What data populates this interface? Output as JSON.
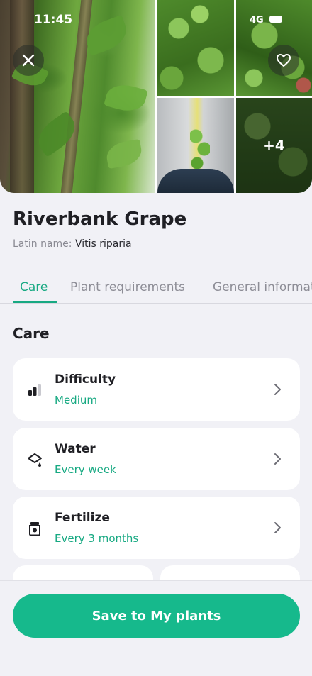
{
  "status_bar": {
    "time": "11:45",
    "network": "4G"
  },
  "gallery": {
    "more_count": "+4"
  },
  "plant": {
    "name": "Riverbank Grape",
    "latin_label": "Latin name:",
    "latin_value": "Vitis riparia"
  },
  "tabs": [
    {
      "label": "Care",
      "active": true
    },
    {
      "label": "Plant requirements",
      "active": false
    },
    {
      "label": "General information",
      "active": false
    }
  ],
  "care": {
    "title": "Care",
    "items": [
      {
        "title": "Difficulty",
        "value": "Medium",
        "icon": "signal-bars-icon"
      },
      {
        "title": "Water",
        "value": "Every week",
        "icon": "watering-can-icon"
      },
      {
        "title": "Fertilize",
        "value": "Every 3 months",
        "icon": "fertilizer-bag-icon"
      }
    ]
  },
  "actions": {
    "save_label": "Save to My plants"
  },
  "colors": {
    "accent": "#17a982",
    "button": "#16b98c",
    "background": "#f1f1f6"
  }
}
